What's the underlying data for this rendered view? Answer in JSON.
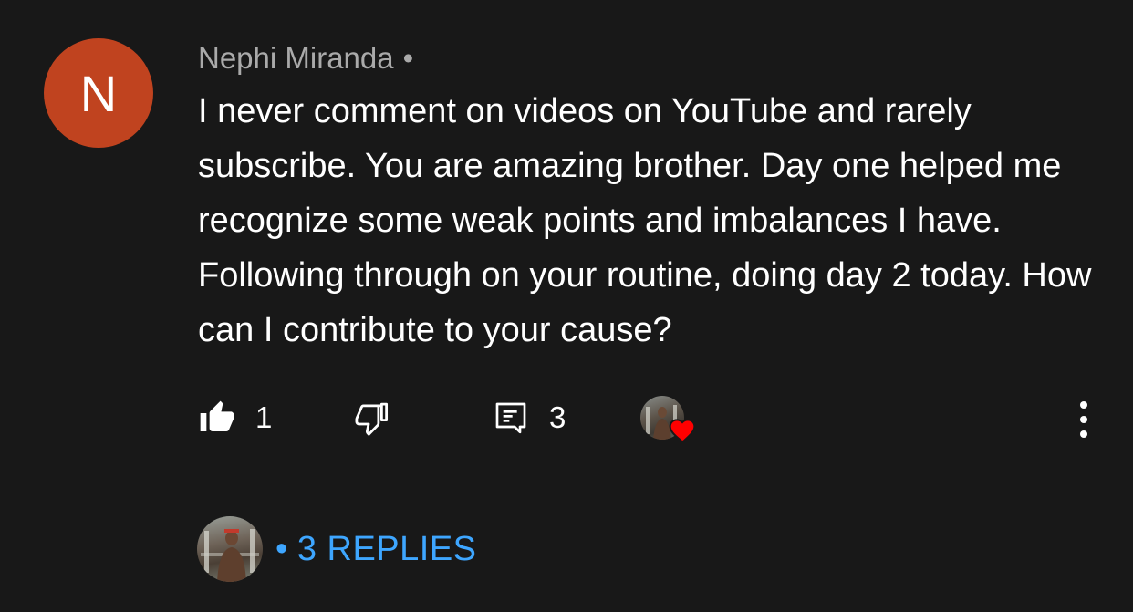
{
  "comment": {
    "author_initial": "N",
    "avatar_color": "#c0431f",
    "author": "Nephi Miranda",
    "separator": "•",
    "text": "I never comment on videos on YouTube and rarely subscribe. You are amazing brother. Day one helped me recognize some weak points and imbalances I have. Following through on your routine, doing day 2 today. How can I contribute to your cause?"
  },
  "actions": {
    "like_icon": "thumbs-up-filled-icon",
    "like_count": "1",
    "dislike_icon": "thumbs-down-outline-icon",
    "reply_icon": "comment-icon",
    "reply_count": "3",
    "heart_color": "#ff0000",
    "menu_icon": "more-vertical-icon"
  },
  "replies": {
    "separator": "•",
    "label": "3 REPLIES",
    "link_color": "#3ea6ff"
  }
}
